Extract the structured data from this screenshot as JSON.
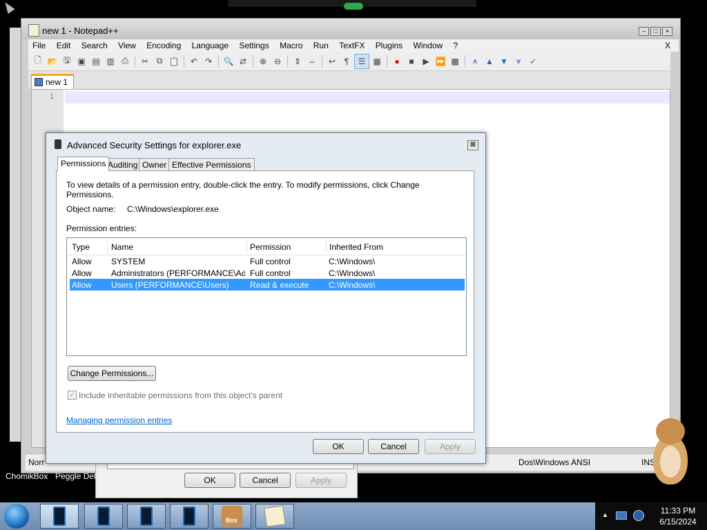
{
  "desktop": {
    "labels": [
      "ChomikBox",
      "Peggle Delu"
    ]
  },
  "notepad": {
    "title": "new 1 - Notepad++",
    "menu": [
      "File",
      "Edit",
      "Search",
      "View",
      "Encoding",
      "Language",
      "Settings",
      "Macro",
      "Run",
      "TextFX",
      "Plugins",
      "Window",
      "?"
    ],
    "menu_close": "X",
    "tab_label": "new 1",
    "line_number": "1",
    "status_left": "Norr",
    "status_mid": "Dos\\Windows  ANSI",
    "status_right": "INS"
  },
  "background_dialog": {
    "ok": "OK",
    "cancel": "Cancel",
    "apply": "Apply"
  },
  "dialog": {
    "title": "Advanced Security Settings for explorer.exe",
    "close": "⊠",
    "tabs": [
      "Permissions",
      "Auditing",
      "Owner",
      "Effective Permissions"
    ],
    "instructions": "To view details of a permission entry, double-click the entry. To modify permissions, click Change Permissions.",
    "object_name_label": "Object name:",
    "object_name_value": "C:\\Windows\\explorer.exe",
    "entries_label": "Permission entries:",
    "columns": [
      "Type",
      "Name",
      "Permission",
      "Inherited From"
    ],
    "rows": [
      {
        "type": "Allow",
        "name": "SYSTEM",
        "permission": "Full control",
        "inherited": "C:\\Windows\\"
      },
      {
        "type": "Allow",
        "name": "Administrators (PERFORMANCE\\Adm...",
        "permission": "Full control",
        "inherited": "C:\\Windows\\"
      },
      {
        "type": "Allow",
        "name": "Users (PERFORMANCE\\Users)",
        "permission": "Read & execute",
        "inherited": "C:\\Windows\\"
      }
    ],
    "selected_row": 2,
    "change_button": "Change Permissions...",
    "include_checkbox_label": "Include inheritable permissions from this object's parent",
    "include_checked": true,
    "help_link": "Managing permission entries",
    "ok": "OK",
    "cancel": "Cancel",
    "apply": "Apply"
  },
  "taskbar": {
    "time": "11:33 PM",
    "date": "6/15/2024",
    "box_label": "Box"
  },
  "colors": {
    "selection": "#3399ff",
    "link": "#0066cc",
    "tab_accent": "#f5a623"
  }
}
